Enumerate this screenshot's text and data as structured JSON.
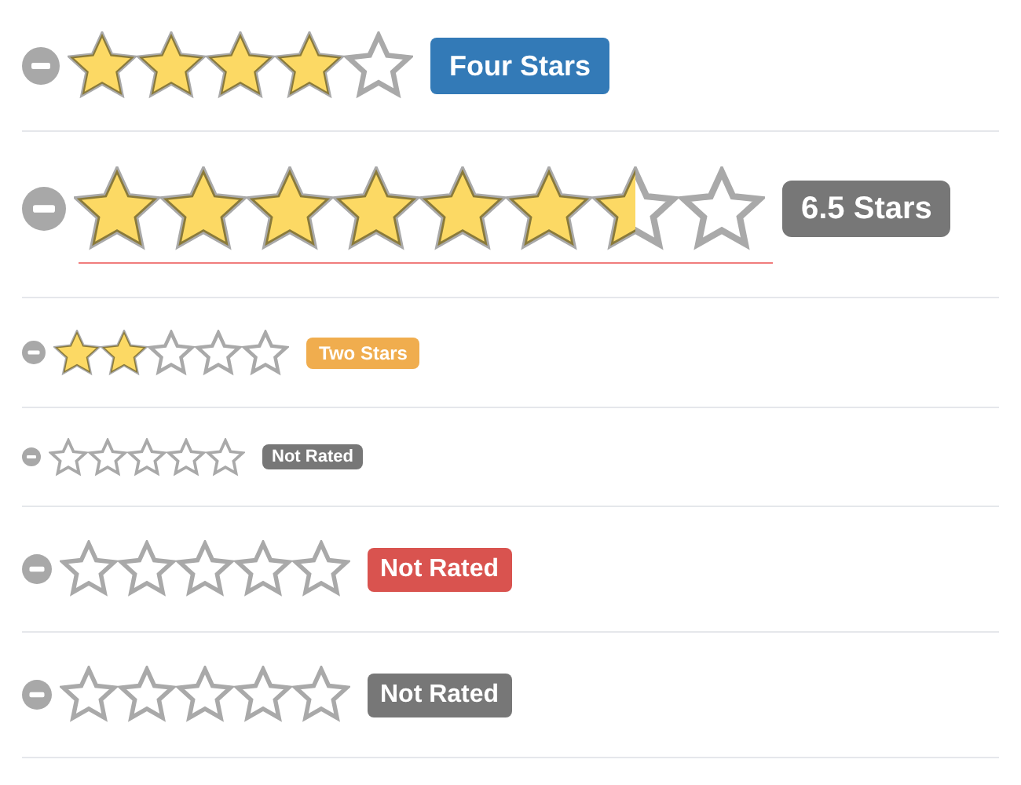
{
  "ratings": [
    {
      "stars": 4,
      "label": "Four Stars",
      "color": "#337ab7"
    },
    {
      "stars": 6.5,
      "label": "6.5 Stars",
      "color": "#777777"
    },
    {
      "stars": 2,
      "label": "Two Stars",
      "color": "#f0ad4e"
    },
    {
      "stars": 0,
      "label": "Not Rated",
      "color": "#777777"
    },
    {
      "stars": 0,
      "label": "Not Rated",
      "color": "#d9534f"
    },
    {
      "stars": 0,
      "label": "Not Rated",
      "color": "#777777"
    }
  ]
}
